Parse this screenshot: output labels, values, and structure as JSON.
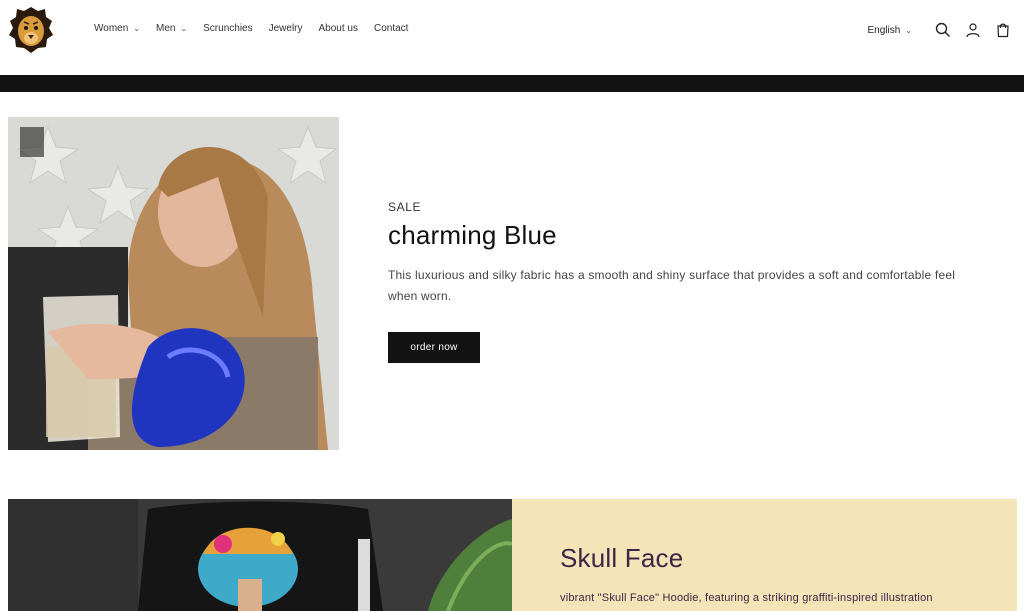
{
  "header": {
    "logo_icon": "lion-logo-icon",
    "nav": [
      {
        "label": "Women",
        "has_dropdown": true
      },
      {
        "label": "Men",
        "has_dropdown": true
      },
      {
        "label": "Scrunchies",
        "has_dropdown": false
      },
      {
        "label": "Jewelry",
        "has_dropdown": false
      },
      {
        "label": "About us",
        "has_dropdown": false
      },
      {
        "label": "Contact",
        "has_dropdown": false
      }
    ],
    "language": "English",
    "icons": [
      "search-icon",
      "account-icon",
      "cart-icon"
    ]
  },
  "hero": {
    "eyebrow": "SALE",
    "title": "charming Blue",
    "description": "This luxurious and silky fabric has a smooth and shiny surface that provides a soft and comfortable feel when worn.",
    "button_label": "order now"
  },
  "section2": {
    "title": "Skull Face",
    "description": "vibrant \"Skull Face\" Hoodie, featuring a striking graffiti-inspired illustration",
    "panel_color": "#f5e4b8",
    "text_color": "#3b2446"
  },
  "colors": {
    "bar": "#121212",
    "button": "#121212"
  }
}
